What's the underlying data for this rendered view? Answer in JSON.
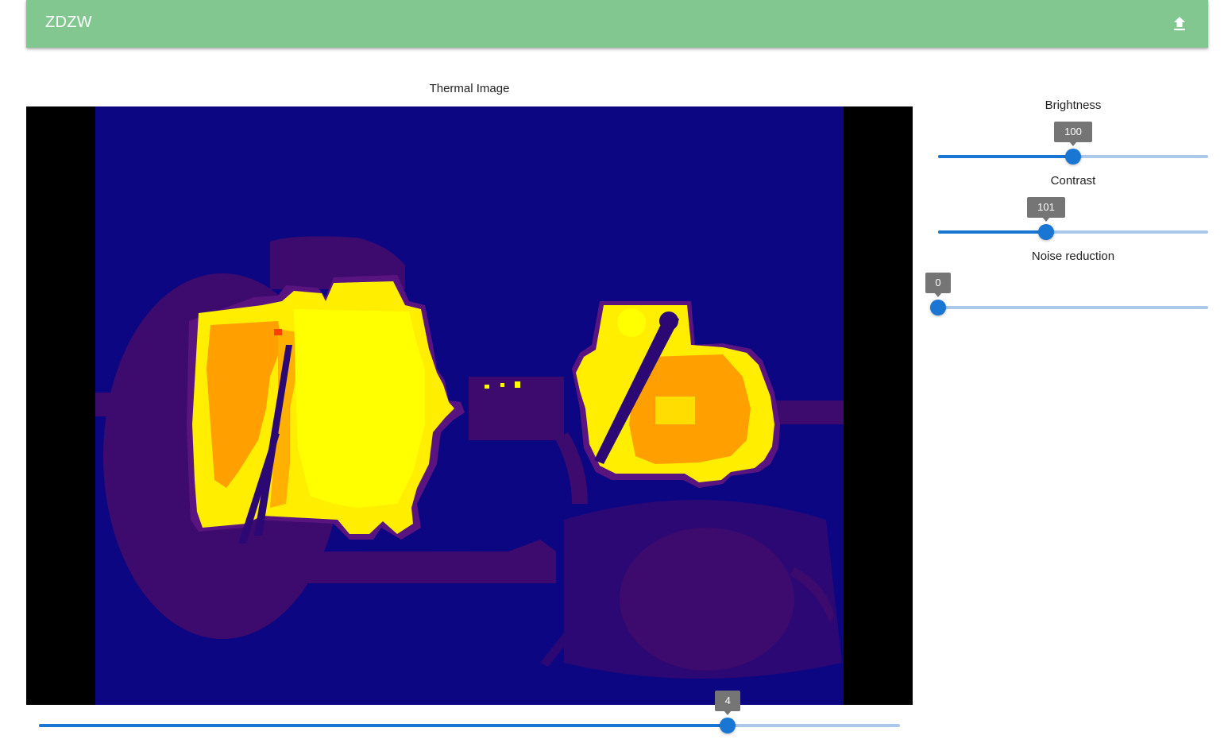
{
  "appbar": {
    "title": "ZDZW",
    "upload_icon": "upload-icon"
  },
  "image_panel": {
    "title": "Thermal Image",
    "frame_slider": {
      "value": 4,
      "value_label": "4",
      "fraction": 0.8
    }
  },
  "controls": {
    "brightness": {
      "label": "Brightness",
      "value": 100,
      "value_label": "100",
      "fraction": 0.5
    },
    "contrast": {
      "label": "Contrast",
      "value": 101,
      "value_label": "101",
      "fraction": 0.4
    },
    "noise_reduction": {
      "label": "Noise reduction",
      "value": 0,
      "value_label": "0",
      "fraction": 0.0
    }
  },
  "colors": {
    "appbar": "#81c78f",
    "slider_accent": "#1976d2",
    "slider_rail": "#a9c8ea",
    "thermal_cold": "#0d0683",
    "thermal_mid": "#3d0a6e",
    "thermal_warm": "#ff9e00",
    "thermal_hot": "#ffff00"
  }
}
